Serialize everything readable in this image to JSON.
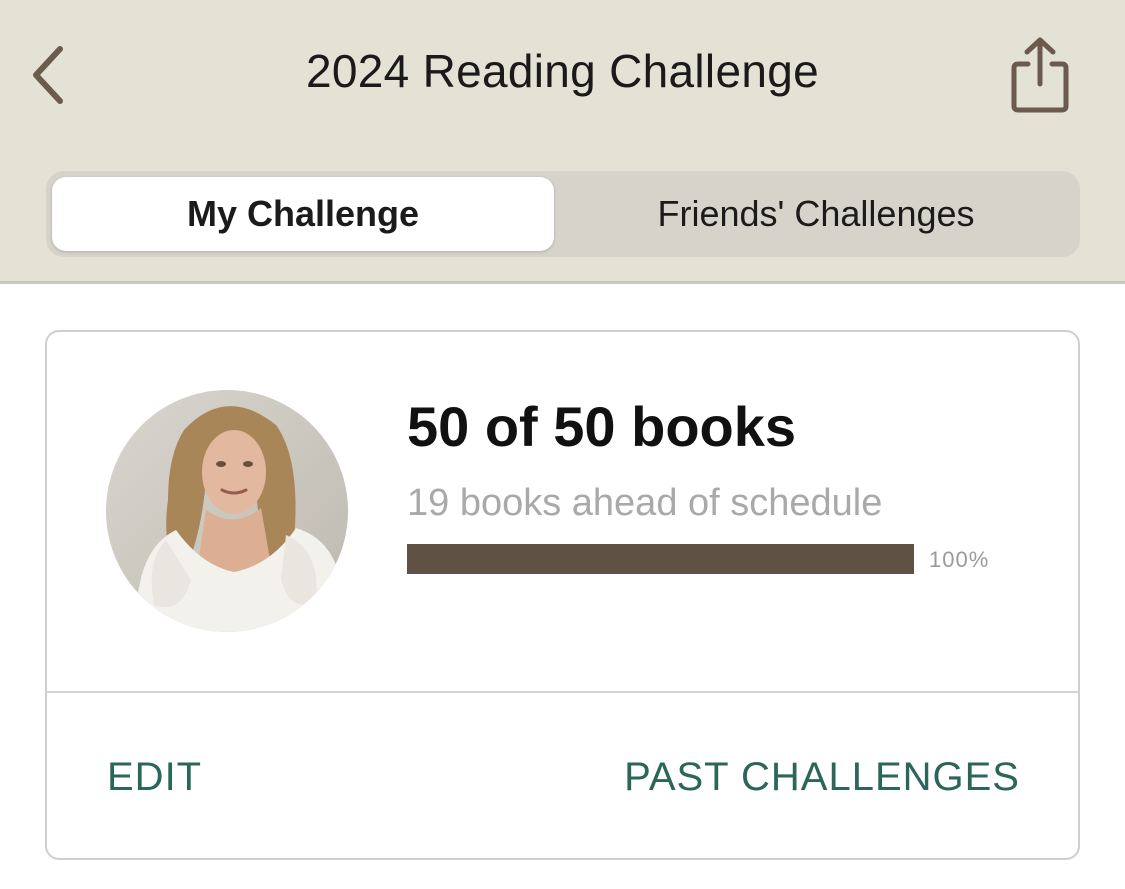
{
  "header": {
    "title": "2024 Reading Challenge",
    "back_icon": "chevron-left-icon",
    "share_icon": "share-icon"
  },
  "tabs": [
    {
      "label": "My Challenge",
      "active": true
    },
    {
      "label": "Friends' Challenges",
      "active": false
    }
  ],
  "challenge": {
    "progress_text": "50 of 50 books",
    "schedule_text": "19 books ahead of schedule",
    "progress_percent": 100,
    "progress_label": "100%",
    "avatar": "user-avatar-photo"
  },
  "actions": {
    "edit_label": "EDIT",
    "past_label": "PAST CHALLENGES"
  },
  "colors": {
    "header_bg": "#e4e1d5",
    "bar_fill": "#5f5143",
    "action_text": "#2c6559",
    "icon": "#6a5b4d"
  }
}
